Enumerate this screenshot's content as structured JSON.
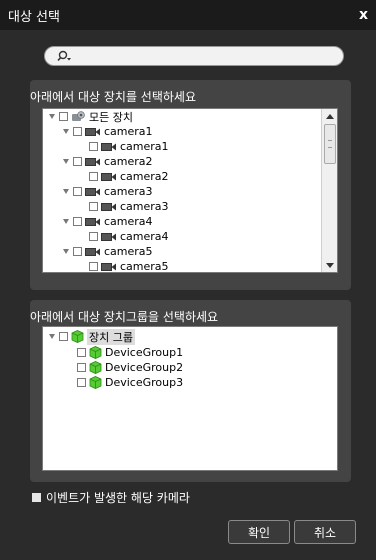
{
  "window": {
    "title": "대상 선택",
    "close_label": "x"
  },
  "search": {
    "placeholder": ""
  },
  "device_panel": {
    "title": "아래에서 대상 장치를 선택하세요",
    "root": {
      "label": "모든 장치"
    },
    "items": [
      {
        "label": "camera1",
        "child": "camera1"
      },
      {
        "label": "camera2",
        "child": "camera2"
      },
      {
        "label": "camera3",
        "child": "camera3"
      },
      {
        "label": "camera4",
        "child": "camera4"
      },
      {
        "label": "camera5",
        "child": "camera5"
      }
    ]
  },
  "group_panel": {
    "title": "아래에서 대상 장치그룹을 선택하세요",
    "root": {
      "label": "장치 그룹"
    },
    "items": [
      {
        "label": "DeviceGroup1"
      },
      {
        "label": "DeviceGroup2"
      },
      {
        "label": "DeviceGroup3"
      }
    ]
  },
  "event_option": {
    "label": "이벤트가 발생한 해당 카메라"
  },
  "buttons": {
    "ok": "확인",
    "cancel": "취소"
  },
  "colors": {
    "background": "#2b2b2b",
    "titlebar": "#1b1b1b",
    "panel": "#444444",
    "group_icon": "#55cc33"
  }
}
